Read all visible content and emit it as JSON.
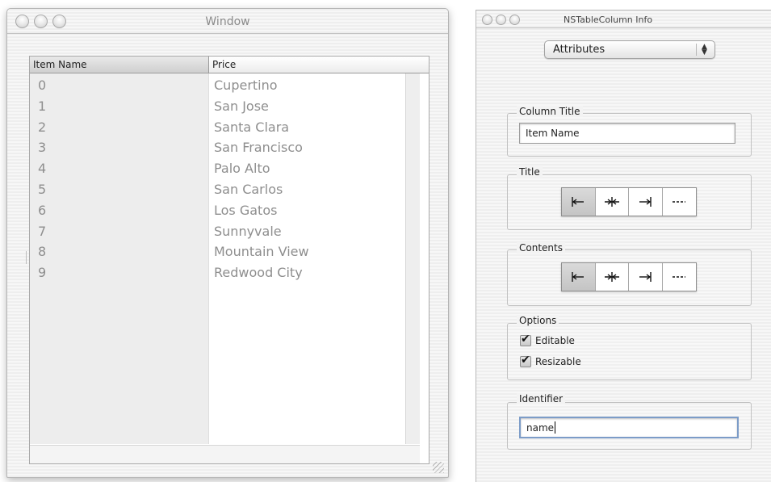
{
  "window": {
    "title": "Window",
    "table": {
      "columns": [
        "Item Name",
        "Price"
      ],
      "rows": [
        [
          "0",
          "Cupertino"
        ],
        [
          "1",
          "San Jose"
        ],
        [
          "2",
          "Santa Clara"
        ],
        [
          "3",
          "San Francisco"
        ],
        [
          "4",
          "Palo Alto"
        ],
        [
          "5",
          "San Carlos"
        ],
        [
          "6",
          "Los Gatos"
        ],
        [
          "7",
          "Sunnyvale"
        ],
        [
          "8",
          "Mountain View"
        ],
        [
          "9",
          "Redwood City"
        ]
      ]
    }
  },
  "inspector": {
    "title": "NSTableColumn Info",
    "popup_value": "Attributes",
    "column_title": {
      "label": "Column Title",
      "value": "Item Name"
    },
    "title_alignment": {
      "label": "Title",
      "options": [
        "align-left-icon",
        "align-center-icon",
        "align-right-icon",
        "align-natural-icon"
      ],
      "selected": "align-left-icon"
    },
    "contents_alignment": {
      "label": "Contents",
      "options": [
        "align-left-icon",
        "align-center-icon",
        "align-right-icon",
        "align-natural-icon"
      ],
      "selected": "align-left-icon"
    },
    "options": {
      "label": "Options",
      "editable": {
        "label": "Editable",
        "checked": true
      },
      "resizable": {
        "label": "Resizable",
        "checked": true
      }
    },
    "identifier": {
      "label": "Identifier",
      "value": "name"
    }
  }
}
